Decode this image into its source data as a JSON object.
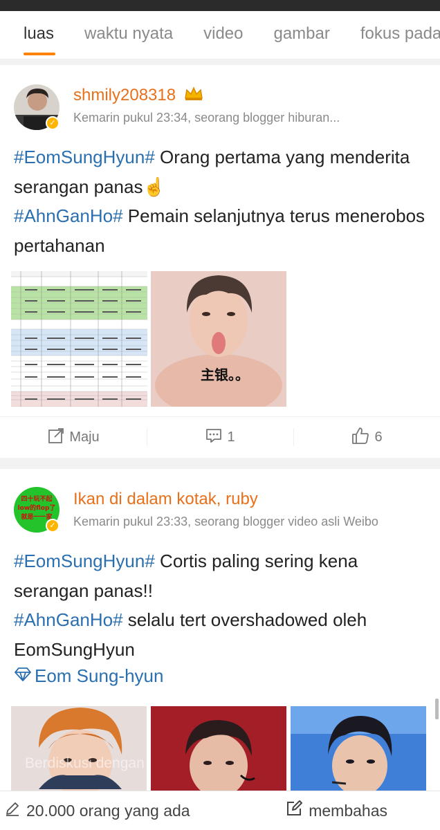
{
  "tabs": [
    "luas",
    "waktu nyata",
    "video",
    "gambar",
    "fokus pada"
  ],
  "post1": {
    "username": "shmily208318",
    "meta": "Kemarin pukul 23:34, seorang blogger hiburan...",
    "tag1": "#EomSungHyun#",
    "text1": " Orang pertama yang menderita serangan panas☝️",
    "tag2": "#AhnGanHo#",
    "text2": " Pemain selanjutnya terus menerobos pertahanan",
    "image2_caption": "主银。。",
    "actions": {
      "repost": "Maju",
      "comments": "1",
      "likes": "6"
    }
  },
  "post2": {
    "username": "Ikan di dalam kotak, ruby",
    "meta": "Kemarin pukul 23:33, seorang blogger video asli Weibo",
    "avatar_text": "四十玩不起 low的flop了 就是一一家",
    "tag1": "#EomSungHyun#",
    "text1": " Cortis paling sering kena serangan panas!!",
    "tag2": "#AhnGanHo#",
    "text2": " selalu tert overshadowed oleh EomSungHyun",
    "topic": "Eom Sung-hyun"
  },
  "overlay": "Berdiskusi dengan",
  "bottom_bar": {
    "left": "20.000 orang yang ada",
    "right": "membahas"
  },
  "colors": {
    "accent": "#ff8200",
    "username": "#e8701a",
    "hashtag": "#2a6fb0"
  }
}
